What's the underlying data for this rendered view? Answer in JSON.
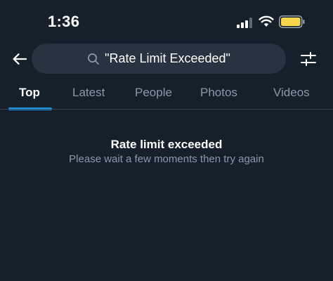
{
  "status_bar": {
    "time": "1:36",
    "icons": [
      "cellular-signal-icon",
      "wifi-icon",
      "battery-icon"
    ],
    "battery_color": "#f8d649"
  },
  "header": {
    "back_icon": "arrow-left-icon",
    "search_icon": "search-icon",
    "search_query": "\"Rate Limit Exceeded\"",
    "filter_icon": "sliders-icon"
  },
  "tabs": [
    {
      "label": "Top",
      "active": true
    },
    {
      "label": "Latest",
      "active": false
    },
    {
      "label": "People",
      "active": false
    },
    {
      "label": "Photos",
      "active": false
    },
    {
      "label": "Videos",
      "active": false
    }
  ],
  "message": {
    "title": "Rate limit exceeded",
    "body": "Please wait a few moments then try again"
  },
  "colors": {
    "background": "#15202b",
    "search_background": "#273340",
    "accent": "#1d9bf0",
    "secondary_text": "#8b98a5",
    "divider": "#38444d"
  }
}
